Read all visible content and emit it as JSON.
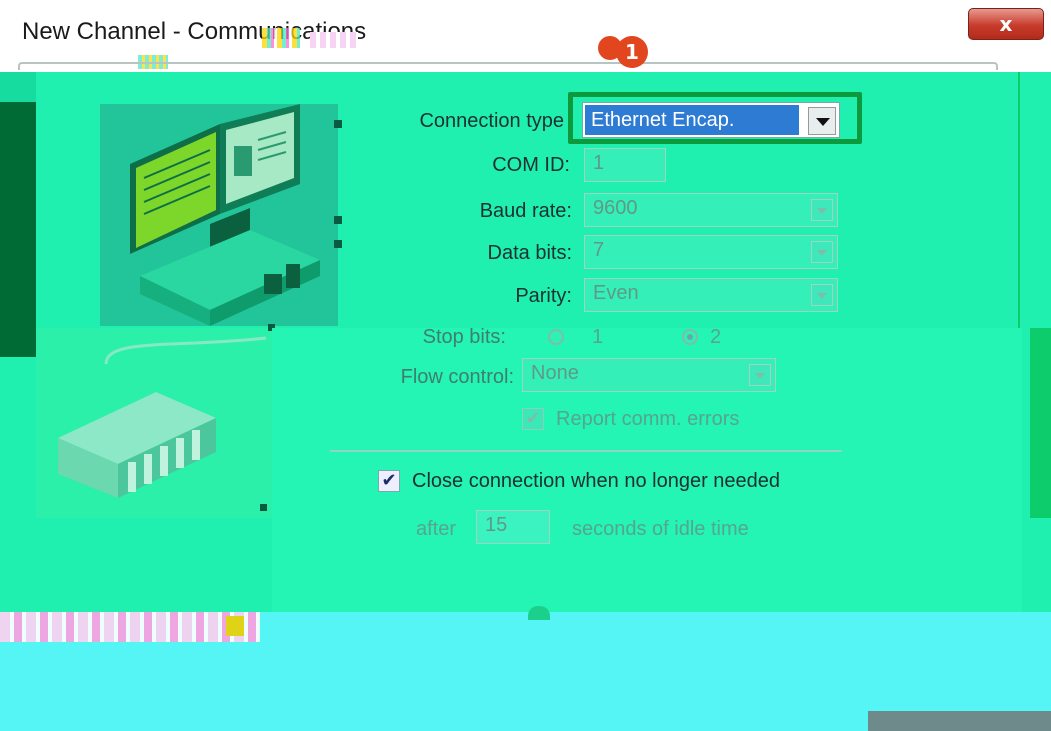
{
  "window": {
    "title": "New Channel - Communications",
    "badge_number": "1",
    "close_label": "x"
  },
  "form": {
    "connection_type": {
      "label": "Connection type",
      "value": "Ethernet Encap."
    },
    "com_id": {
      "label": "COM ID:",
      "value": "1"
    },
    "baud_rate": {
      "label": "Baud rate:",
      "value": "9600"
    },
    "data_bits": {
      "label": "Data bits:",
      "value": "7"
    },
    "parity": {
      "label": "Parity:",
      "value": "Even"
    },
    "stop_bits": {
      "label": "Stop bits:",
      "options": [
        "1",
        "2"
      ],
      "selected": "2"
    },
    "flow_control": {
      "label": "Flow control:",
      "value": "None"
    },
    "report_errors": {
      "label": "Report comm. errors",
      "checked": true
    },
    "close_connection": {
      "label": "Close connection when no longer needed",
      "checked": true
    },
    "idle": {
      "prefix": "after",
      "value": "15",
      "suffix": "seconds of idle time"
    }
  },
  "colors": {
    "highlight_box": "#0d9a3c",
    "selected_value_bg": "#2e7bd4",
    "badge": "#e2461e",
    "close_button": "#c73b2b"
  }
}
